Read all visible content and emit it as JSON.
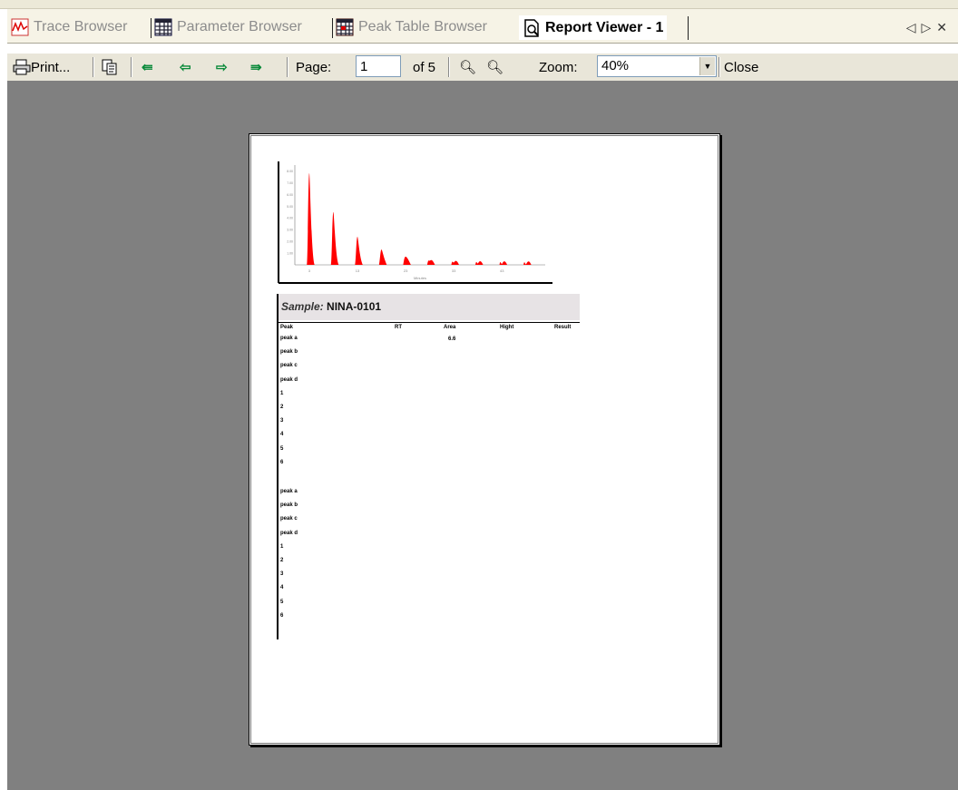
{
  "tabs": [
    {
      "label": "Trace Browser",
      "icon": "trace-icon",
      "active": false
    },
    {
      "label": "Parameter Browser",
      "icon": "grid-icon",
      "active": false
    },
    {
      "label": "Peak Table Browser",
      "icon": "grid-red-icon",
      "active": false
    },
    {
      "label": "Report Viewer - 1",
      "icon": "report-icon",
      "active": true
    }
  ],
  "tab_nav": {
    "prev": "◁",
    "next": "▷",
    "close": "✕"
  },
  "toolbar": {
    "print_label": "Print...",
    "page_label": "Page:",
    "page_value": "1",
    "of_label": "of 5",
    "zoom_label": "Zoom:",
    "zoom_value": "40%",
    "close_label": "Close"
  },
  "report": {
    "sample_label": "Sample:",
    "sample_value": "NINA-0101",
    "columns": [
      "Peak",
      "RT",
      "Area",
      "Hight",
      "Result"
    ],
    "first_area": "6.6",
    "rows_group1": [
      "peak a",
      "peak b",
      "peak c",
      "peak d",
      "1",
      "2",
      "3",
      "4",
      "5",
      "6"
    ],
    "rows_group2": [
      "peak a",
      "peak b",
      "peak c",
      "peak d",
      "1",
      "2",
      "3",
      "4",
      "5",
      "6"
    ]
  },
  "chart_data": {
    "type": "area",
    "xlabel": "Minutes",
    "ylabel": "",
    "y_ticks": [
      "8.00",
      "7.00",
      "6.00",
      "5.00",
      "4.00",
      "3.00",
      "2.00",
      "1.00"
    ],
    "x_ticks": [
      "3",
      "13",
      "23",
      "33",
      "43"
    ],
    "peaks_x": [
      3,
      8,
      13,
      18,
      23,
      28,
      33,
      38,
      43,
      48
    ],
    "peaks_y": [
      7.8,
      4.5,
      2.4,
      1.3,
      0.7,
      0.35,
      0.2,
      0.12,
      0.08,
      0.05
    ],
    "ylim": [
      0,
      8.5
    ],
    "xlim": [
      0,
      52
    ],
    "color": "#ff0000"
  },
  "colors": {
    "viewer_bg": "#808080",
    "peak": "#ff0000",
    "header_bg": "#e7e3e5"
  }
}
